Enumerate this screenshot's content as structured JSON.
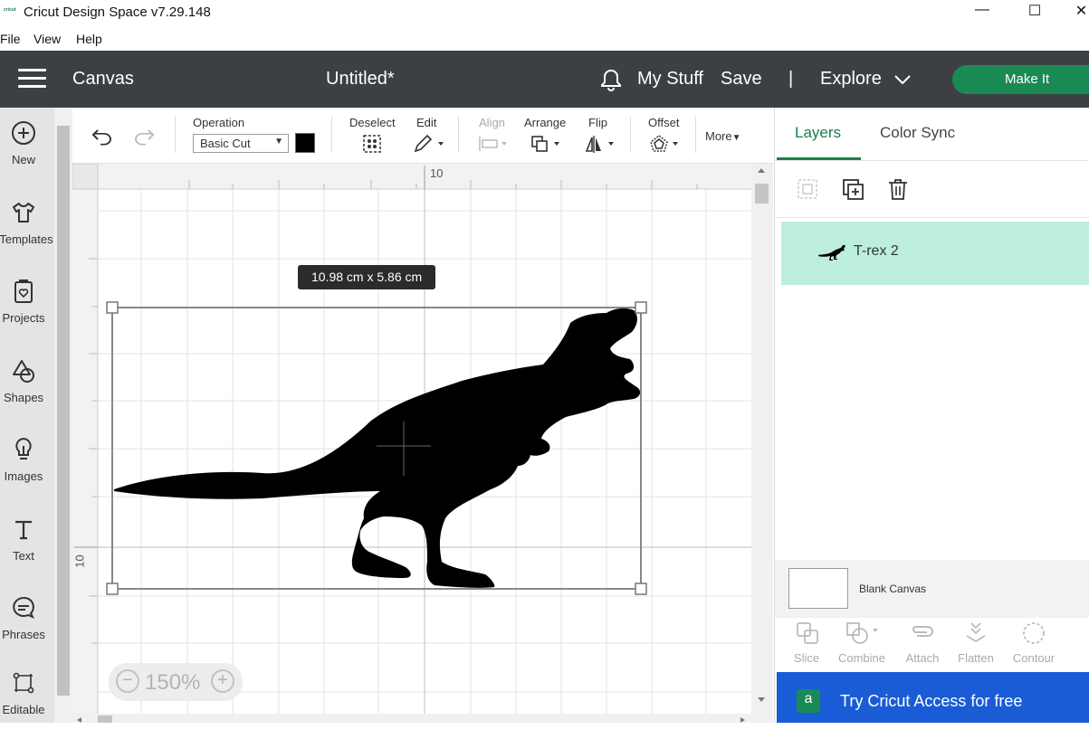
{
  "app": {
    "logo_text": "cricut",
    "window_title": "Cricut Design Space  v7.29.148",
    "minimize_glyph": "—",
    "maximize_glyph": "☐",
    "close_glyph": "✕"
  },
  "menu": {
    "items": [
      "File",
      "View",
      "Help"
    ]
  },
  "header": {
    "section": "Canvas",
    "doc_title": "Untitled*",
    "my_stuff": "My Stuff",
    "save": "Save",
    "divider": "|",
    "explore": "Explore",
    "make_it": "Make It",
    "bg_color": "#3c4043",
    "make_it_color": "#1a8a55"
  },
  "sidebar": {
    "items": [
      {
        "label": "New",
        "icon": "plus-circle-icon"
      },
      {
        "label": "Templates",
        "icon": "shirt-icon"
      },
      {
        "label": "Projects",
        "icon": "projects-icon"
      },
      {
        "label": "Shapes",
        "icon": "shapes-icon"
      },
      {
        "label": "Images",
        "icon": "lightbulb-icon"
      },
      {
        "label": "Text",
        "icon": "text-icon"
      },
      {
        "label": "Phrases",
        "icon": "speech-bubble-icon"
      },
      {
        "label": "Editable",
        "icon": "editable-icon"
      }
    ]
  },
  "toolbar": {
    "operation_label": "Operation",
    "operation_value": "Basic Cut",
    "operation_color": "#000000",
    "deselect": "Deselect",
    "edit": "Edit",
    "align": "Align",
    "arrange": "Arrange",
    "flip": "Flip",
    "offset": "Offset",
    "more": "More"
  },
  "canvas": {
    "ruler_top_label": "10",
    "ruler_left_label": "10",
    "dimension_label": "10.98  cm x 5.86  cm",
    "zoom": "150%",
    "zoom_minus": "−",
    "zoom_plus": "+"
  },
  "layers_panel": {
    "tabs": [
      "Layers",
      "Color Sync"
    ],
    "layer_name": "T-rex 2",
    "layer_bg": "#bdeedc",
    "blank_canvas": "Blank Canvas",
    "bottom_tools": [
      "Slice",
      "Combine",
      "Attach",
      "Flatten",
      "Contour"
    ],
    "access_badge": "a",
    "access_text": "Try Cricut Access for free",
    "access_color": "#1a5bd6"
  }
}
